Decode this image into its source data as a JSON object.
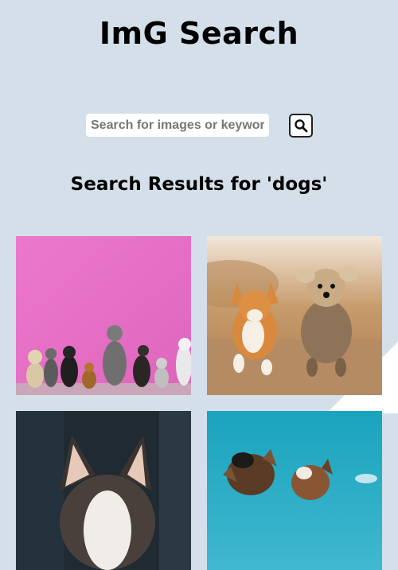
{
  "app": {
    "title": "ImG Search"
  },
  "search": {
    "placeholder": "Search for images or keywords",
    "value": ""
  },
  "results": {
    "heading": "Search Results for 'dogs'",
    "images": [
      {
        "subject": "group of dogs sitting against pink wall"
      },
      {
        "subject": "corgi and yorkshire terrier running on path"
      },
      {
        "subject": "husky close-up portrait"
      },
      {
        "subject": "dogs looking up at blue sky"
      }
    ]
  },
  "colors": {
    "background": "#d4dfe9",
    "text": "#000000"
  }
}
